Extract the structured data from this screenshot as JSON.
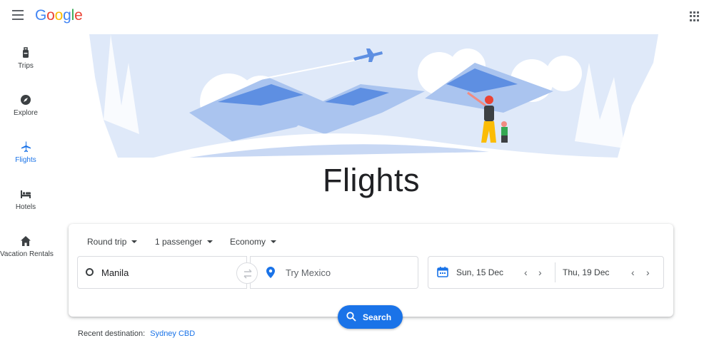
{
  "header": {
    "logo_letters": [
      "G",
      "o",
      "o",
      "g",
      "l",
      "e"
    ],
    "logo_colors": [
      "#4285f4",
      "#ea4335",
      "#fbbc05",
      "#4285f4",
      "#34a853",
      "#ea4335"
    ],
    "menu_icon": "hamburger-menu-icon",
    "apps_icon": "apps-grid-icon"
  },
  "sidebar": {
    "items": [
      {
        "label": "Trips",
        "icon": "luggage-icon",
        "active": false
      },
      {
        "label": "Explore",
        "icon": "compass-icon",
        "active": false
      },
      {
        "label": "Flights",
        "icon": "airplane-icon",
        "active": true
      },
      {
        "label": "Hotels",
        "icon": "bed-icon",
        "active": false
      },
      {
        "label": "Vacation Rentals",
        "icon": "house-icon",
        "active": false
      }
    ]
  },
  "page": {
    "title": "Flights"
  },
  "search": {
    "trip_type": "Round trip",
    "passengers": "1 passenger",
    "cabin_class": "Economy",
    "origin": "Manila",
    "destination_placeholder": "Try Mexico",
    "departure_date": "Sun, 15 Dec",
    "return_date": "Thu, 19 Dec",
    "search_label": "Search"
  },
  "recent": {
    "label": "Recent destination:",
    "destination": "Sydney CBD"
  },
  "colors": {
    "accent": "#1a73e8",
    "hero_light": "#dfe9f9",
    "hero_mid": "#aac4ef",
    "hero_dark": "#5e8fe2"
  }
}
